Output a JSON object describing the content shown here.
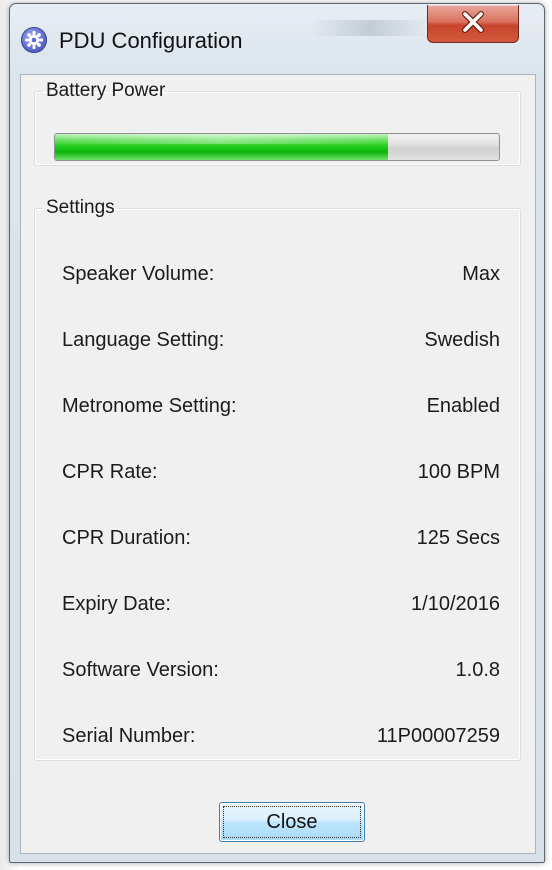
{
  "window": {
    "title": "PDU Configuration"
  },
  "battery": {
    "group_label": "Battery Power",
    "level_fraction": 0.75,
    "bar_color": "#17c513"
  },
  "settings": {
    "group_label": "Settings",
    "rows": [
      {
        "label": "Speaker Volume:",
        "value": "Max"
      },
      {
        "label": "Language Setting:",
        "value": "Swedish"
      },
      {
        "label": "Metronome Setting:",
        "value": "Enabled"
      },
      {
        "label": "CPR Rate:",
        "value": "100 BPM"
      },
      {
        "label": "CPR Duration:",
        "value": "125 Secs"
      },
      {
        "label": "Expiry Date:",
        "value": "1/10/2016"
      },
      {
        "label": "Software Version:",
        "value": "1.0.8"
      },
      {
        "label": "Serial Number:",
        "value": "11P00007259"
      }
    ]
  },
  "buttons": {
    "close_label": "Close"
  },
  "icons": {
    "app": "gear-icon",
    "window_close": "close-icon"
  },
  "colors": {
    "close_button_red": "#c7442d",
    "focus_button_blue": "#bee6fd"
  }
}
